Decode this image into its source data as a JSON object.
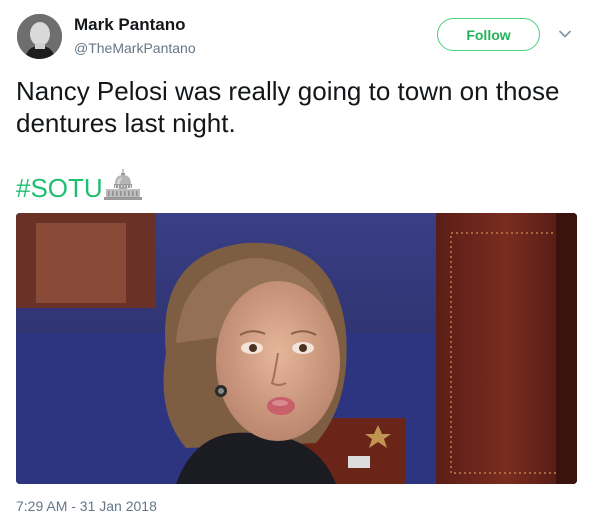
{
  "author": {
    "name": "Mark Pantano",
    "handle": "@TheMarkPantano"
  },
  "follow_button": {
    "label": "Follow"
  },
  "menu": {
    "icon": "chevron-down-icon"
  },
  "tweet": {
    "text": "Nancy Pelosi was really going to town on those dentures last night.",
    "hashtag": "#SOTU",
    "hashtag_icon": "capitol-building-icon",
    "timestamp": "7:29 AM - 31 Jan 2018"
  },
  "colors": {
    "accent": "#1fbf72",
    "follow_border": "#4ad07c",
    "secondary_text": "#657786",
    "primary_text": "#14171a"
  }
}
